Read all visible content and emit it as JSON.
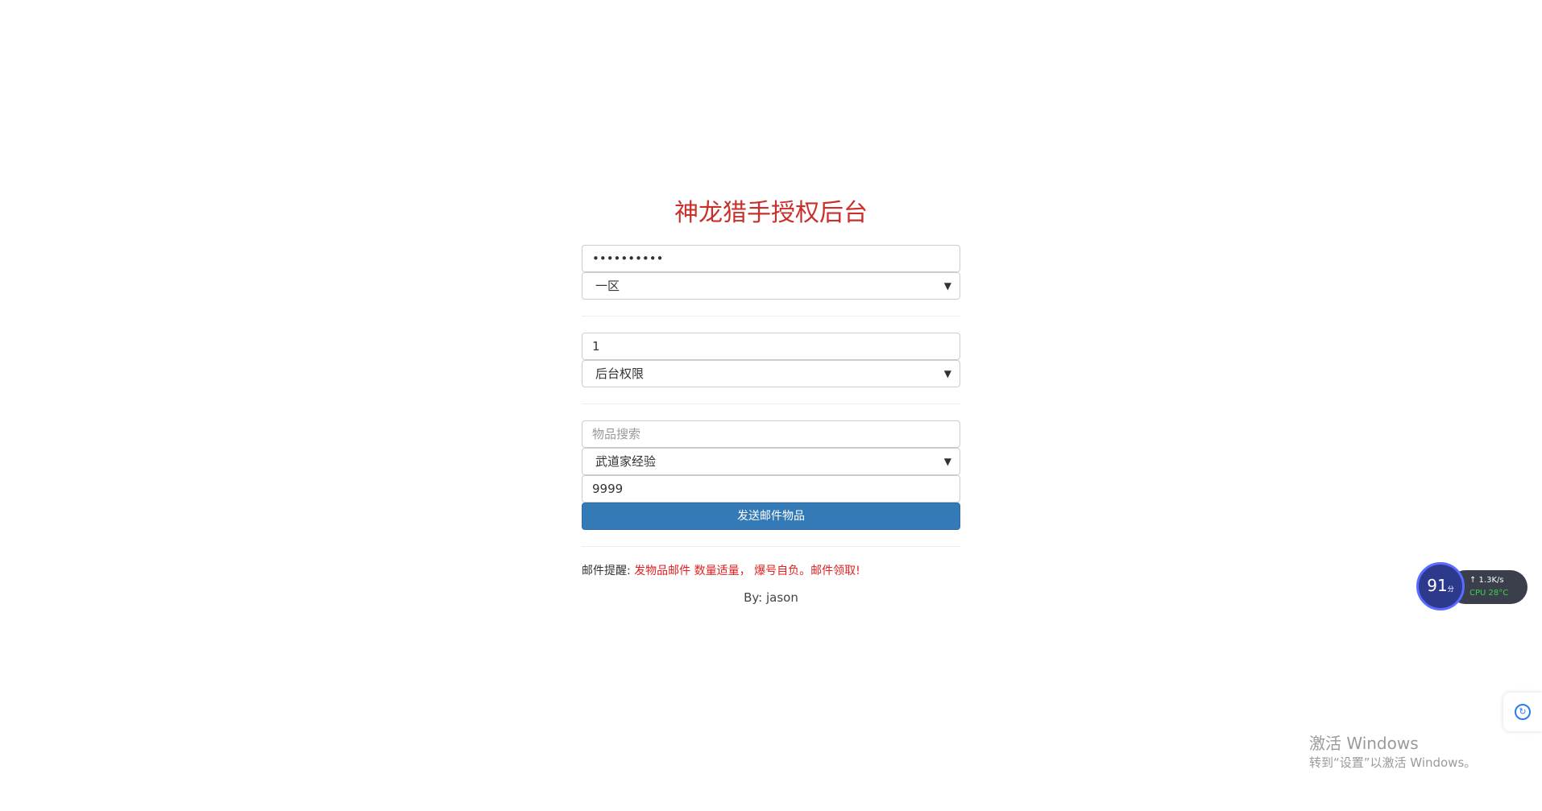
{
  "title": "神龙猎手授权后台",
  "section1": {
    "password_value": "••••••••••",
    "server_select": "一区"
  },
  "section2": {
    "id_value": "1",
    "permission_select": "后台权限"
  },
  "section3": {
    "search_placeholder": "物品搜索",
    "item_select": "武道家经验",
    "quantity_value": "9999",
    "send_button": "发送邮件物品"
  },
  "notice": {
    "label": "邮件提醒:",
    "message": "发物品邮件 数量适量， 爆号自负。邮件领取!"
  },
  "byline": "By:  jason",
  "widget": {
    "score": "91",
    "score_unit": "分",
    "speed": "↑ 1.3K/s",
    "cpu": "CPU 28°C"
  },
  "watermark": {
    "line1": "激活 Windows",
    "line2": "转到“设置”以激活 Windows。"
  },
  "colors": {
    "title": "#c9302c",
    "button": "#337ab7",
    "notice_red": "#e02020"
  },
  "icons": {
    "chevron": "chevron-down-icon",
    "side_tab": "translate-icon"
  }
}
